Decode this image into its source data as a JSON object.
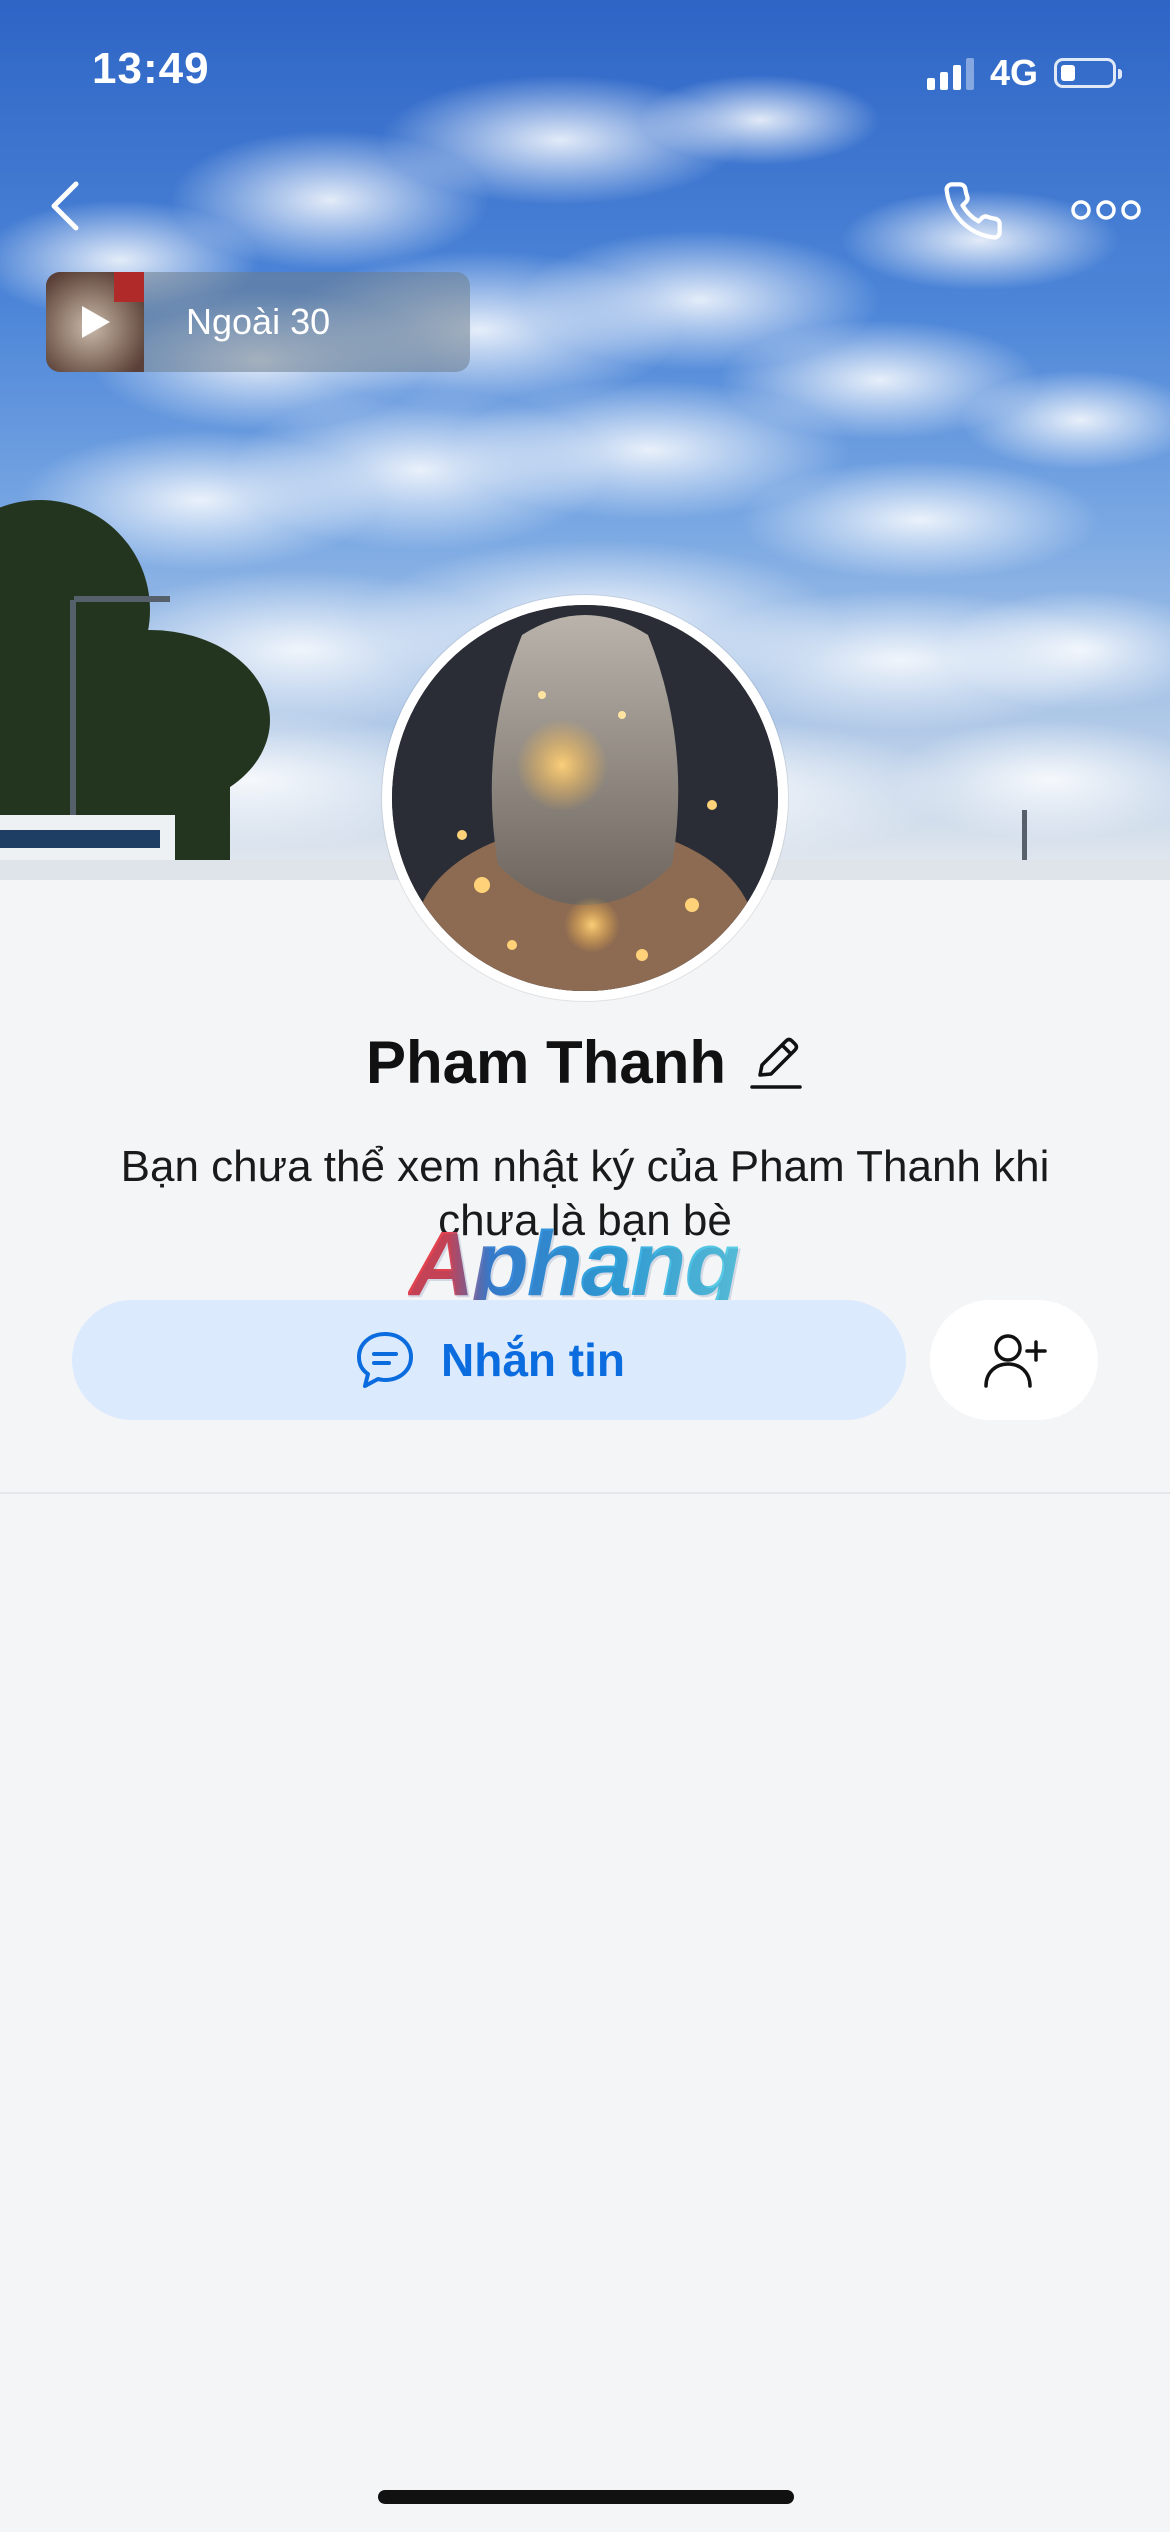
{
  "status_bar": {
    "time": "13:49",
    "network": "4G",
    "signal_bars_active": 3,
    "battery_level": 0.25
  },
  "header": {
    "back_icon": "chevron-left-icon",
    "call_icon": "phone-icon",
    "more_icon": "more-horizontal-icon"
  },
  "music": {
    "title": "Ngoài 30",
    "play_icon": "play-icon"
  },
  "profile": {
    "name": "Pham Thanh",
    "edit_icon": "pencil-icon",
    "info_text": "Bạn chưa thể xem nhật ký của Pham Thanh khi chưa là bạn bè"
  },
  "watermark": {
    "text": "Aphang"
  },
  "actions": {
    "message_label": "Nhắn tin",
    "message_icon": "chat-bubble-icon",
    "add_friend_icon": "user-plus-icon"
  },
  "colors": {
    "accent": "#0a6cde",
    "message_button_bg": "#dceafd",
    "page_bg": "#f4f5f7"
  }
}
